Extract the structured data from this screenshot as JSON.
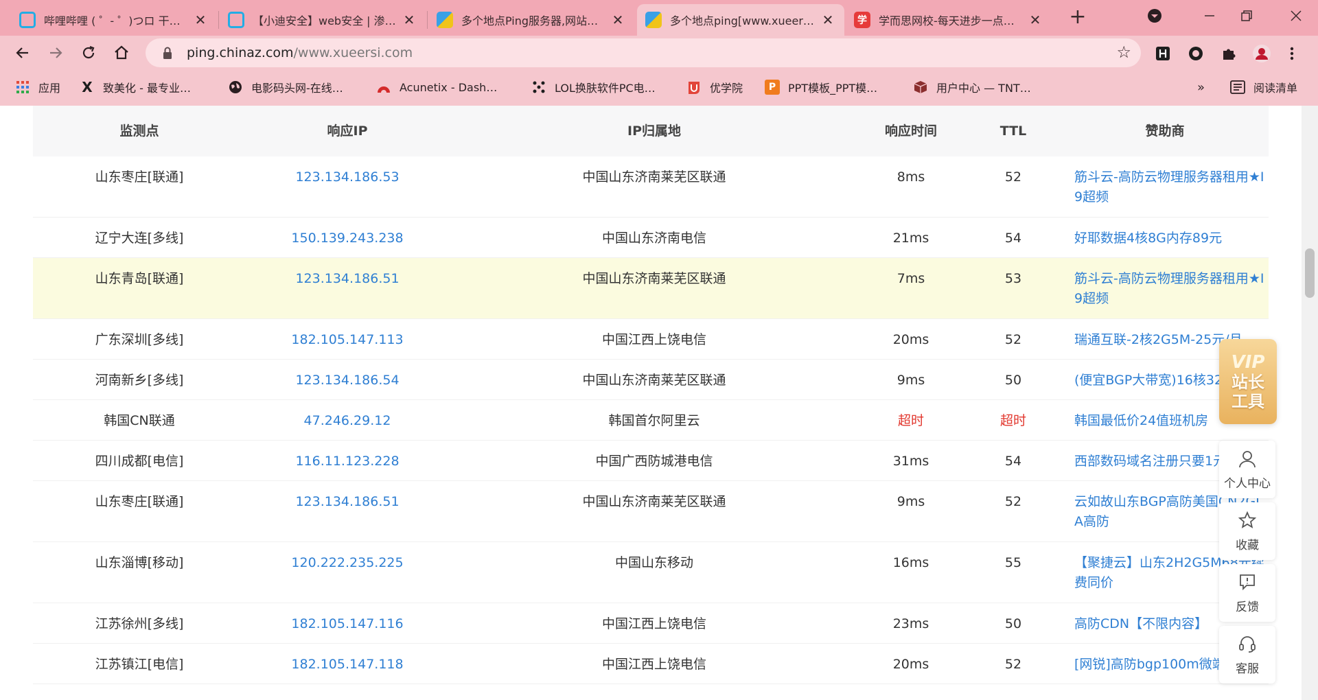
{
  "tabs": [
    {
      "title": "哔哩哔哩 ( ゜- ゜)つロ 干…",
      "icon": "bilibili-icon"
    },
    {
      "title": "【小迪安全】web安全 | 渗…",
      "icon": "bilibili-icon"
    },
    {
      "title": "多个地点Ping服务器,网站…",
      "icon": "chinaz-icon"
    },
    {
      "title": "多个地点ping[www.xueer…",
      "icon": "chinaz-icon"
    },
    {
      "title": "学而思网校-每天进步一点…",
      "icon": "xueersi-icon"
    }
  ],
  "address": {
    "host": "ping.chinaz.com",
    "path": "/www.xueersi.com"
  },
  "bookmarks": [
    {
      "label": "应用"
    },
    {
      "label": "致美化 - 最专业…"
    },
    {
      "label": "电影码头网-在线…"
    },
    {
      "label": "Acunetix - Dash…"
    },
    {
      "label": "LOL换肤软件PC电…"
    },
    {
      "label": "优学院"
    },
    {
      "label": "PPT模板_PPT模…"
    },
    {
      "label": "用户中心 — TNT…"
    },
    {
      "label": "»"
    },
    {
      "label": "阅读清单"
    }
  ],
  "xes_icon_char": "学",
  "bm_icons": {
    "ppt": "P",
    "xiaomi": "X"
  },
  "table": {
    "headers": [
      "监测点",
      "响应IP",
      "IP归属地",
      "响应时间",
      "TTL",
      "赞助商"
    ],
    "rows": [
      {
        "point": "山东枣庄[联通]",
        "ip": "123.134.186.53",
        "location": "中国山东济南莱芜区联通",
        "time": "8ms",
        "ttl": "52",
        "sponsor": "筋斗云-高防云物理服务器租用★I9超频"
      },
      {
        "point": "辽宁大连[多线]",
        "ip": "150.139.243.238",
        "location": "中国山东济南电信",
        "time": "21ms",
        "ttl": "54",
        "sponsor": "好耶数据4核8G内存89元"
      },
      {
        "point": "山东青岛[联通]",
        "ip": "123.134.186.51",
        "location": "中国山东济南莱芜区联通",
        "time": "7ms",
        "ttl": "53",
        "sponsor": "筋斗云-高防云物理服务器租用★I9超频"
      },
      {
        "point": "广东深圳[多线]",
        "ip": "182.105.147.113",
        "location": "中国江西上饶电信",
        "time": "20ms",
        "ttl": "52",
        "sponsor": "瑞通互联-2核2G5M-25元/月"
      },
      {
        "point": "河南新乡[多线]",
        "ip": "123.134.186.54",
        "location": "中国山东济南莱芜区联通",
        "time": "9ms",
        "ttl": "50",
        "sponsor": "(便宜BGP大带宽)16核32g"
      },
      {
        "point": "韩国CN联通",
        "ip": "47.246.29.12",
        "location": "韩国首尔阿里云",
        "time": "超时",
        "ttl": "超时",
        "sponsor": "韩国最低价24值班机房"
      },
      {
        "point": "四川成都[电信]",
        "ip": "116.11.123.228",
        "location": "中国广西防城港电信",
        "time": "31ms",
        "ttl": "54",
        "sponsor": "西部数码域名注册只要1元"
      },
      {
        "point": "山东枣庄[联通]",
        "ip": "123.134.186.51",
        "location": "中国山东济南莱芜区联通",
        "time": "9ms",
        "ttl": "52",
        "sponsor": "云如故山东BGP高防美国CN2GIA高防"
      },
      {
        "point": "山东淄博[移动]",
        "ip": "120.222.235.225",
        "location": "中国山东移动",
        "time": "16ms",
        "ttl": "55",
        "sponsor": "【聚捷云】山东2H2G5M68元续费同价"
      },
      {
        "point": "江苏徐州[多线]",
        "ip": "182.105.147.116",
        "location": "中国江西上饶电信",
        "time": "23ms",
        "ttl": "50",
        "sponsor": "高防CDN【不限内容】"
      },
      {
        "point": "江苏镇江[电信]",
        "ip": "182.105.147.118",
        "location": "中国江西上饶电信",
        "time": "20ms",
        "ttl": "52",
        "sponsor": "[网锐]高防bgp100m微端6"
      }
    ]
  },
  "vip": {
    "badge": "VIP",
    "line1": "站长",
    "line2": "工具"
  },
  "side_tools": [
    {
      "label": "个人中心"
    },
    {
      "label": "收藏"
    },
    {
      "label": "反馈"
    },
    {
      "label": "客服"
    }
  ],
  "colors": {
    "tabstrip": "#f2a9b5",
    "toolbar": "#f5c7ce",
    "link": "#2f7fd3",
    "timeout": "#e2372e",
    "highlight_row": "#fbfbdf"
  }
}
